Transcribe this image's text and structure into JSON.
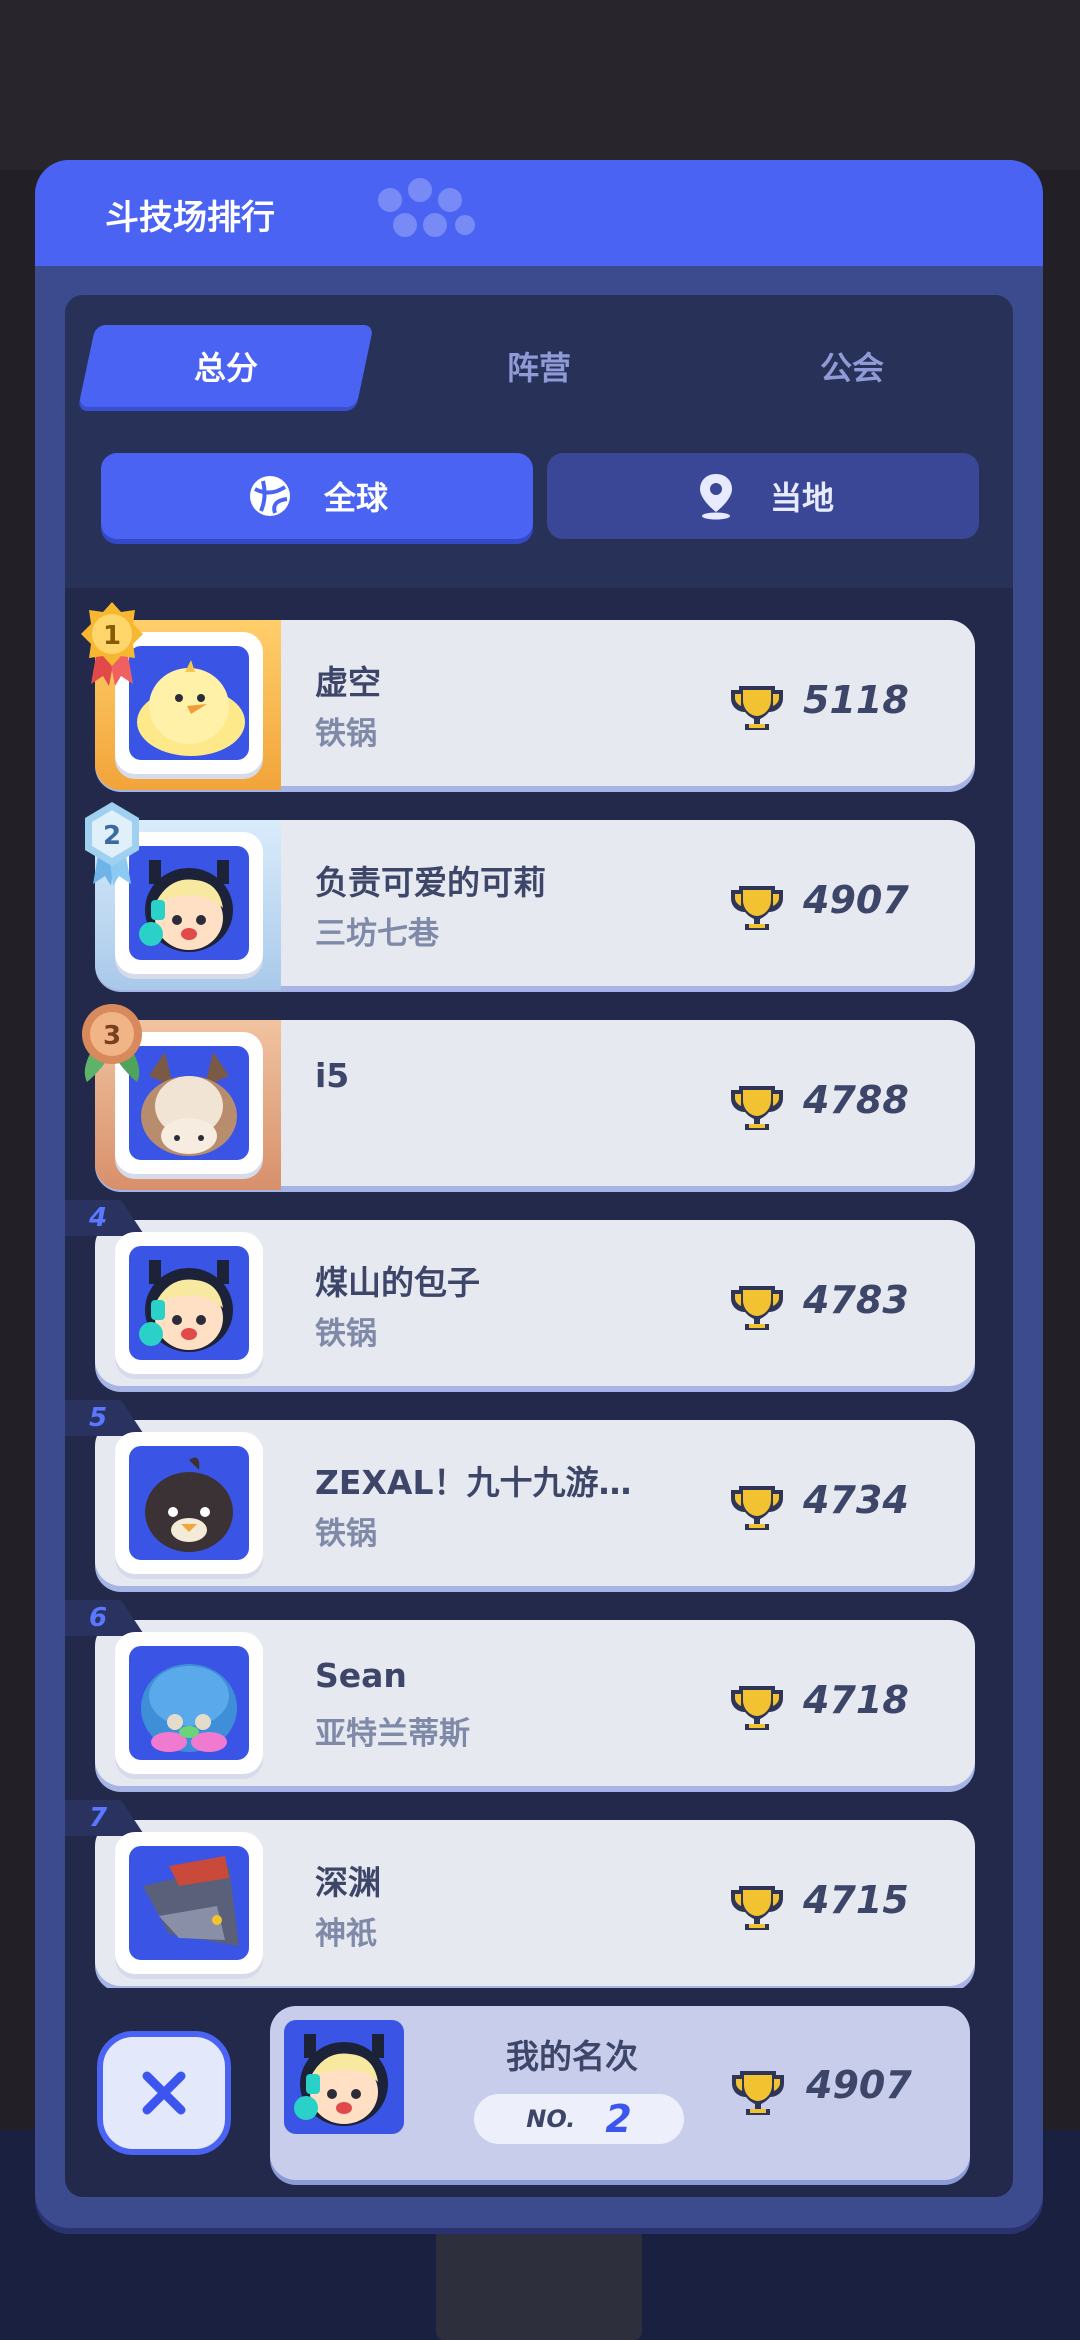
{
  "panel": {
    "title": "斗技场排行"
  },
  "tabs": [
    {
      "label": "总分",
      "active": true
    },
    {
      "label": "阵营",
      "active": false
    },
    {
      "label": "公会",
      "active": false
    }
  ],
  "filters": [
    {
      "label": "全球",
      "icon": "globe-icon",
      "active": true
    },
    {
      "label": "当地",
      "icon": "location-pin-icon",
      "active": false
    }
  ],
  "rankings": [
    {
      "rank": "1",
      "name": "虚空",
      "guild": "铁锅",
      "score": "5118",
      "avatar": "yellow-chick"
    },
    {
      "rank": "2",
      "name": "负责可爱的可莉",
      "guild": "三坊七巷",
      "score": "4907",
      "avatar": "blonde-girl"
    },
    {
      "rank": "3",
      "name": "i5",
      "guild": "",
      "score": "4788",
      "avatar": "brown-dog"
    },
    {
      "rank": "4",
      "name": "煤山的包子",
      "guild": "铁锅",
      "score": "4783",
      "avatar": "blonde-girl"
    },
    {
      "rank": "5",
      "name": "ZEXAL！九十九游…",
      "guild": "铁锅",
      "score": "4734",
      "avatar": "dark-penguin"
    },
    {
      "rank": "6",
      "name": "Sean",
      "guild": "亚特兰蒂斯",
      "score": "4718",
      "avatar": "blue-blob"
    },
    {
      "rank": "7",
      "name": "深渊",
      "guild": "神祇",
      "score": "4715",
      "avatar": "shark-knight"
    }
  ],
  "my_rank": {
    "label": "我的名次",
    "no_label": "NO.",
    "rank": "2",
    "score": "4907"
  },
  "colors": {
    "accent": "#4a63f2",
    "panel": "#3c4a8e",
    "card": "#e7e9f1",
    "gold": "#f2a43a",
    "silver": "#a9c9ea",
    "bronze": "#d7906b",
    "trophy": "#f2c230"
  }
}
